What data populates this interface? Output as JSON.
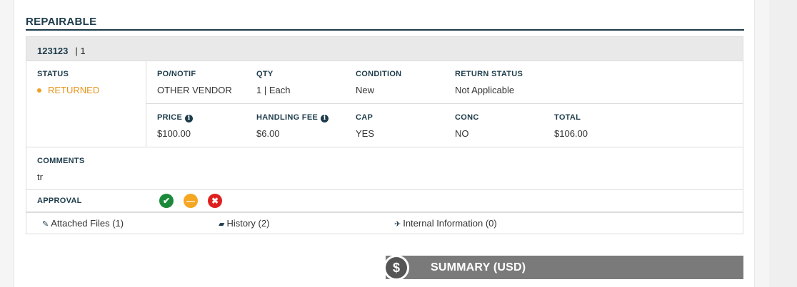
{
  "section": {
    "title": "REPAIRABLE"
  },
  "item": {
    "id": "123123",
    "qty_sep": "| 1",
    "status_label": "STATUS",
    "status_value": "RETURNED",
    "status_color": "#e8941a",
    "fields_row1": [
      {
        "label": "PO/NOTIF",
        "value": "OTHER VENDOR"
      },
      {
        "label": "QTY",
        "value": "1 | Each"
      },
      {
        "label": "CONDITION",
        "value": "New"
      },
      {
        "label": "RETURN STATUS",
        "value": "Not Applicable"
      }
    ],
    "fields_row2": [
      {
        "label": "PRICE",
        "value": "$100.00"
      },
      {
        "label": "HANDLING FEE",
        "value": "$6.00"
      },
      {
        "label": "CAP",
        "value": "YES"
      },
      {
        "label": "CONC",
        "value": "NO"
      },
      {
        "label": "TOTAL",
        "value": "$106.00"
      }
    ],
    "comments_label": "COMMENTS",
    "comments_value": "tr",
    "approval_label": "APPROVAL",
    "approval_icons": {
      "approve": "✔",
      "neutral": "—",
      "reject": "✖"
    }
  },
  "links": {
    "attached": "Attached Files (1)",
    "history": "History (2)",
    "internal": "Internal Information (0)"
  },
  "summary": {
    "title": "SUMMARY (USD)",
    "icon": "$"
  },
  "colors": {
    "accent": "#1d3b4a",
    "approve": "#1a8a3a",
    "neutral": "#f5a623",
    "reject": "#e02020"
  }
}
